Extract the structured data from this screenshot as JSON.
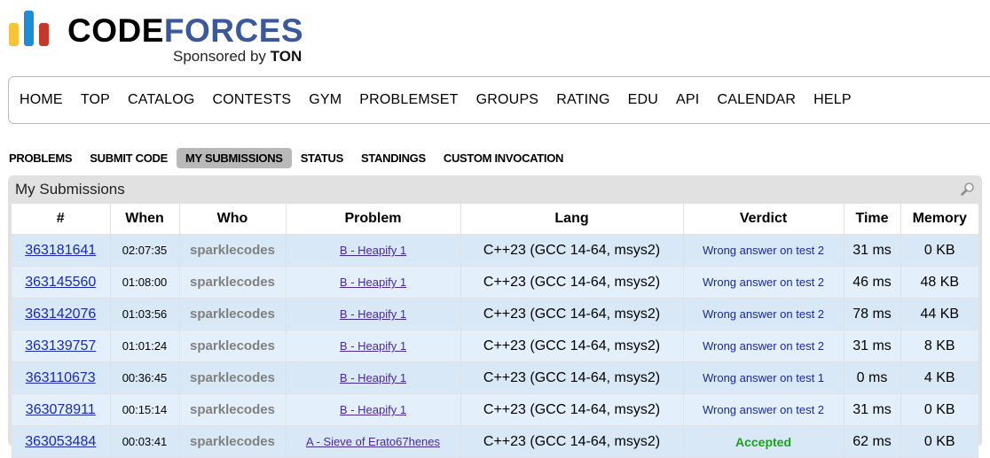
{
  "logo": {
    "word_code": "CODE",
    "word_forces": "FORCES",
    "sponsor_prefix": "Sponsored by",
    "sponsor_name": "TON"
  },
  "main_nav": [
    "HOME",
    "TOP",
    "CATALOG",
    "CONTESTS",
    "GYM",
    "PROBLEMSET",
    "GROUPS",
    "RATING",
    "EDU",
    "API",
    "CALENDAR",
    "HELP"
  ],
  "sub_nav": [
    {
      "label": "PROBLEMS",
      "active": false
    },
    {
      "label": "SUBMIT CODE",
      "active": false
    },
    {
      "label": "MY SUBMISSIONS",
      "active": true
    },
    {
      "label": "STATUS",
      "active": false
    },
    {
      "label": "STANDINGS",
      "active": false
    },
    {
      "label": "CUSTOM INVOCATION",
      "active": false
    }
  ],
  "panel": {
    "title": "My Submissions",
    "search_icon": "magnifier-icon"
  },
  "table": {
    "headers": [
      "#",
      "When",
      "Who",
      "Problem",
      "Lang",
      "Verdict",
      "Time",
      "Memory"
    ],
    "rows": [
      {
        "id": "363181641",
        "when": "02:07:35",
        "who": "sparklecodes",
        "problem": "B - Heapify 1",
        "lang": "C++23 (GCC 14-64, msys2)",
        "verdict": "Wrong answer on test 2",
        "accepted": false,
        "time": "31 ms",
        "memory": "0 KB"
      },
      {
        "id": "363145560",
        "when": "01:08:00",
        "who": "sparklecodes",
        "problem": "B - Heapify 1",
        "lang": "C++23 (GCC 14-64, msys2)",
        "verdict": "Wrong answer on test 2",
        "accepted": false,
        "time": "46 ms",
        "memory": "48 KB"
      },
      {
        "id": "363142076",
        "when": "01:03:56",
        "who": "sparklecodes",
        "problem": "B - Heapify 1",
        "lang": "C++23 (GCC 14-64, msys2)",
        "verdict": "Wrong answer on test 2",
        "accepted": false,
        "time": "78 ms",
        "memory": "44 KB"
      },
      {
        "id": "363139757",
        "when": "01:01:24",
        "who": "sparklecodes",
        "problem": "B - Heapify 1",
        "lang": "C++23 (GCC 14-64, msys2)",
        "verdict": "Wrong answer on test 2",
        "accepted": false,
        "time": "31 ms",
        "memory": "8 KB"
      },
      {
        "id": "363110673",
        "when": "00:36:45",
        "who": "sparklecodes",
        "problem": "B - Heapify 1",
        "lang": "C++23 (GCC 14-64, msys2)",
        "verdict": "Wrong answer on test 1",
        "accepted": false,
        "time": "0 ms",
        "memory": "4 KB"
      },
      {
        "id": "363078911",
        "when": "00:15:14",
        "who": "sparklecodes",
        "problem": "B - Heapify 1",
        "lang": "C++23 (GCC 14-64, msys2)",
        "verdict": "Wrong answer on test 2",
        "accepted": false,
        "time": "31 ms",
        "memory": "0 KB"
      },
      {
        "id": "363053484",
        "when": "00:03:41",
        "who": "sparklecodes",
        "problem": "A - Sieve of Erato67henes",
        "lang": "C++23 (GCC 14-64, msys2)",
        "verdict": "Accepted",
        "accepted": true,
        "time": "62 ms",
        "memory": "0 KB"
      }
    ]
  },
  "colors": {
    "brand_blue": "#3b5998",
    "link_blue": "#1a2aa8",
    "accepted_green": "#1aa21a",
    "row_bg": "#e3f0fb",
    "row_alt_bg": "#d8e8f6"
  }
}
